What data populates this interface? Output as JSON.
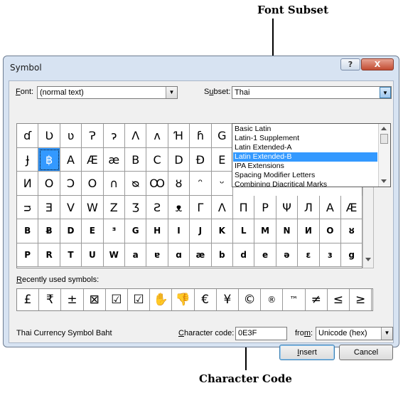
{
  "annotations": {
    "font_subset": "Font Subset",
    "character_code": "Character Code"
  },
  "dialog": {
    "title": "Symbol",
    "help_glyph": "?",
    "close_glyph": "X"
  },
  "font": {
    "label_u": "F",
    "label_rest": "ont:",
    "value": "(normal text)"
  },
  "subset": {
    "label_pre": "S",
    "label_u": "u",
    "label_rest": "bset:",
    "value": "Thai",
    "options": [
      "Basic Latin",
      "Latin-1 Supplement",
      "Latin Extended-A",
      "Latin Extended-B",
      "IPA Extensions",
      "Spacing Modifier Letters",
      "Combining Diacritical Marks"
    ],
    "selected_index": 3
  },
  "symbol_grid": {
    "rows": [
      [
        "ɗ",
        "Ʋ",
        "ʋ",
        "Ɂ",
        "ɂ",
        "Ʌ",
        "ʌ",
        "Ɦ",
        "ɦ",
        "G"
      ],
      [
        "Ɉ",
        "฿",
        "A",
        "Æ",
        "æ",
        "B",
        "C",
        "D",
        "Đ",
        "E"
      ],
      [
        "И",
        "O",
        "Ɔ",
        "O",
        "∩",
        "ᴓ",
        "Ꝏ",
        "ȣ",
        "ᵔ",
        "ᵕ"
      ],
      [
        "ᴝ",
        "Ǝ",
        "V",
        "W",
        "Z",
        "Ʒ",
        "Ƨ",
        "ᴥ",
        "Γ",
        "Λ",
        "Π",
        "Ρ",
        "Ψ",
        "Л",
        "A",
        "Æ"
      ],
      [
        "B",
        "Ƀ",
        "D",
        "E",
        "ᴲ",
        "G",
        "H",
        "I",
        "J",
        "K",
        "L",
        "M",
        "N",
        "И",
        "O",
        "ȣ"
      ],
      [
        "P",
        "R",
        "T",
        "U",
        "W",
        "a",
        "ɐ",
        "ɑ",
        "æ",
        "b",
        "d",
        "e",
        "ə",
        "ɛ",
        "ɜ",
        "g"
      ]
    ]
  },
  "recently_used": {
    "label_u": "R",
    "label_rest": "ecently used symbols:",
    "symbols": [
      "£",
      "₹",
      "±",
      "⊠",
      "☑",
      "☑",
      "✋",
      "👎",
      "€",
      "¥",
      "©",
      "®",
      "™",
      "≠",
      "≤",
      "≥"
    ]
  },
  "status": {
    "char_name": "Thai Currency Symbol Baht",
    "char_code_label_u": "C",
    "char_code_label_rest": "haracter code:",
    "char_code_value": "0E3F",
    "from_label_pre": "fro",
    "from_label_u": "m",
    "from_label_rest": ":",
    "from_value": "Unicode (hex)"
  },
  "buttons": {
    "insert_u": "I",
    "insert_rest": "nsert",
    "cancel": "Cancel"
  }
}
